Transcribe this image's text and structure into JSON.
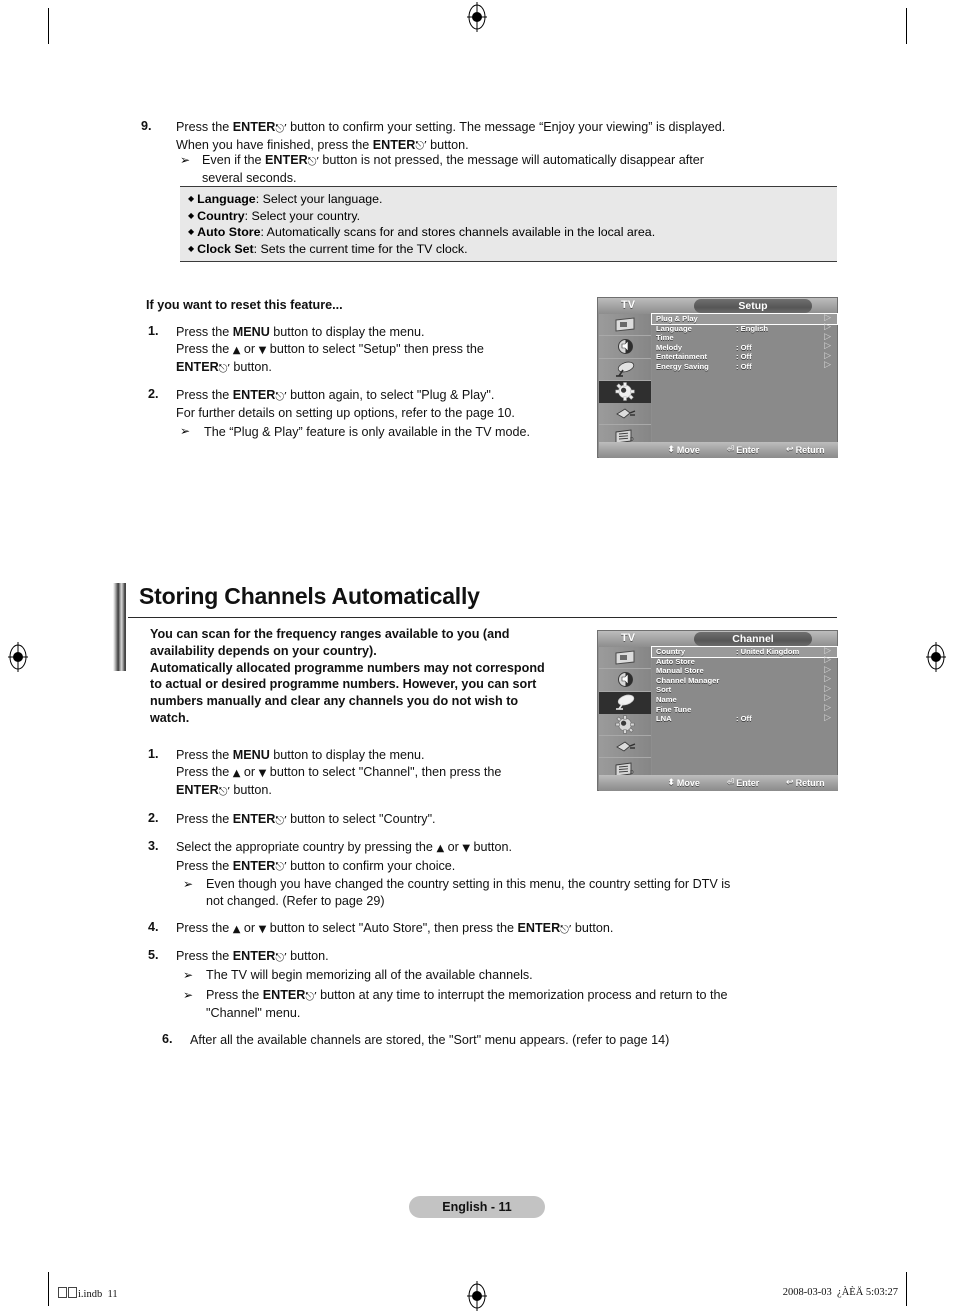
{
  "document": {
    "page_badge": "English - 11",
    "footer_left_file": "i.indb",
    "footer_left_page": "11",
    "footer_right_date": "2008-03-03",
    "footer_right_time": "¿ÀÈÄ 5:03:27"
  },
  "step9": {
    "num": "9.",
    "line1_a": "Press the ",
    "line1_enter": "ENTER",
    "line1_b": " button to confirm your setting. The message “Enjoy your viewing” is displayed.",
    "line2_a": "When you have finished, press the ",
    "line2_enter": "ENTER",
    "line2_b": " button.",
    "note_a": "Even if the ",
    "note_enter": "ENTER",
    "note_b": " button is not pressed, the message will automatically disappear after",
    "note_c": "several seconds."
  },
  "callout": {
    "items": [
      {
        "term": "Language",
        "desc": ": Select your language."
      },
      {
        "term": "Country",
        "desc": ": Select your country."
      },
      {
        "term": "Auto Store",
        "desc": ": Automatically scans for and stores channels available in the local area."
      },
      {
        "term": "Clock Set",
        "desc": ": Sets the current time for the TV clock."
      }
    ]
  },
  "reset_section": {
    "heading": "If you want to reset this feature...",
    "step1": {
      "num": "1.",
      "l1_a": "Press the ",
      "l1_b": "MENU",
      "l1_c": " button to display the menu.",
      "l2_a": "Press the ",
      "l2_up": "▲",
      "l2_or": " or ",
      "l2_down": "▼",
      "l2_b": " button to select \"Setup\" then press the",
      "l3_enter": "ENTER",
      "l3_b": " button."
    },
    "step2": {
      "num": "2.",
      "l1_a": "Press the ",
      "l1_enter": "ENTER",
      "l1_b": " button again, to select \"Plug & Play\".",
      "l2": "For further details on setting up options, refer to the page 10.",
      "note": "The “Plug & Play” feature is only available in the TV mode."
    }
  },
  "osd_setup": {
    "tv_label": "TV",
    "title": "Setup",
    "rows": [
      {
        "label": "Plug & Play",
        "value": "",
        "arrow": "▷",
        "highlighted": true
      },
      {
        "label": "Language",
        "value": ": English",
        "arrow": "▷",
        "highlighted": false
      },
      {
        "label": "Time",
        "value": "",
        "arrow": "▷",
        "highlighted": false
      },
      {
        "label": "Melody",
        "value": ": Off",
        "arrow": "▷",
        "highlighted": false
      },
      {
        "label": "Entertainment",
        "value": ": Off",
        "arrow": "▷",
        "highlighted": false
      },
      {
        "label": "Energy Saving",
        "value": ": Off",
        "arrow": "▷",
        "highlighted": false
      }
    ],
    "icons": [
      {
        "name": "picture-icon",
        "selected": false
      },
      {
        "name": "sound-icon",
        "selected": false
      },
      {
        "name": "channel-satellite-icon",
        "selected": false
      },
      {
        "name": "setup-gear-icon",
        "selected": true
      },
      {
        "name": "input-plug-icon",
        "selected": false
      },
      {
        "name": "application-list-icon",
        "selected": false
      }
    ],
    "hints": [
      {
        "glyph": "⬍",
        "label": "Move"
      },
      {
        "glyph": "⏎",
        "label": "Enter"
      },
      {
        "glyph": "↩",
        "label": "Return"
      }
    ]
  },
  "osd_channel": {
    "tv_label": "TV",
    "title": "Channel",
    "rows": [
      {
        "label": "Country",
        "value": ": United Kingdom",
        "arrow": "▷",
        "highlighted": true
      },
      {
        "label": "Auto Store",
        "value": "",
        "arrow": "▷",
        "highlighted": false
      },
      {
        "label": "Manual Store",
        "value": "",
        "arrow": "▷",
        "highlighted": false
      },
      {
        "label": "Channel Manager",
        "value": "",
        "arrow": "▷",
        "highlighted": false
      },
      {
        "label": "Sort",
        "value": "",
        "arrow": "▷",
        "highlighted": false
      },
      {
        "label": "Name",
        "value": "",
        "arrow": "▷",
        "highlighted": false
      },
      {
        "label": "Fine Tune",
        "value": "",
        "arrow": "▷",
        "highlighted": false
      },
      {
        "label": "LNA",
        "value": ": Off",
        "arrow": "▷",
        "highlighted": false
      }
    ],
    "icons": [
      {
        "name": "picture-icon",
        "selected": false
      },
      {
        "name": "sound-icon",
        "selected": false
      },
      {
        "name": "channel-satellite-icon",
        "selected": true
      },
      {
        "name": "setup-gear-icon",
        "selected": false
      },
      {
        "name": "input-plug-icon",
        "selected": false
      },
      {
        "name": "application-list-icon",
        "selected": false
      }
    ],
    "hints": [
      {
        "glyph": "⬍",
        "label": "Move"
      },
      {
        "glyph": "⏎",
        "label": "Enter"
      },
      {
        "glyph": "↩",
        "label": "Return"
      }
    ]
  },
  "storing": {
    "title": "Storing Channels Automatically",
    "intro_l1": "You can scan for the frequency ranges available to you (and",
    "intro_l2": "availability depends on your country).",
    "intro_l3": "Automatically allocated programme numbers may not correspond",
    "intro_l4": "to actual or desired programme numbers. However, you can sort",
    "intro_l5": "numbers manually and clear any channels you do not wish to",
    "intro_l6": "watch.",
    "step1": {
      "num": "1.",
      "l1_a": "Press the ",
      "l1_b": "MENU",
      "l1_c": " button to display the menu.",
      "l2_a": "Press the ",
      "l2_b": " button to select \"Channel\", then press the",
      "l3_enter": "ENTER",
      "l3_b": " button."
    },
    "step2": {
      "num": "2.",
      "l1_a": "Press the ",
      "l1_enter": "ENTER",
      "l1_b": " button to select \"Country\"."
    },
    "step3": {
      "num": "3.",
      "l1_a": "Select the appropriate country by pressing the ",
      "l1_b": " button.",
      "l2_a": "Press the ",
      "l2_enter": "ENTER",
      "l2_b": " button to confirm your choice.",
      "note_a": "Even though you have changed the country setting in this menu, the country setting for DTV is",
      "note_b": "not changed. (Refer to page 29)"
    },
    "step4": {
      "num": "4.",
      "l1_a": "Press the ",
      "l1_b": " button to select \"Auto Store\", then press the ",
      "l1_enter": "ENTER",
      "l1_c": " button."
    },
    "step5": {
      "num": "5.",
      "l1_a": "Press the ",
      "l1_enter": "ENTER",
      "l1_b": " button.",
      "note1": "The TV will begin memorizing all of the available channels.",
      "note2_a": "Press the ",
      "note2_enter": "ENTER",
      "note2_b": " button at any time to interrupt the memorization process and return to the",
      "note2_c": "\"Channel\" menu."
    },
    "step6": {
      "num": "6.",
      "l1": "After all the available channels are stored, the \"Sort\" menu appears. (refer to page 14)"
    }
  },
  "glyphs": {
    "enter": "⏎",
    "arrow_up": "▲",
    "arrow_down": "▼",
    "note_arrow": "➢",
    "diamond": "◆"
  }
}
